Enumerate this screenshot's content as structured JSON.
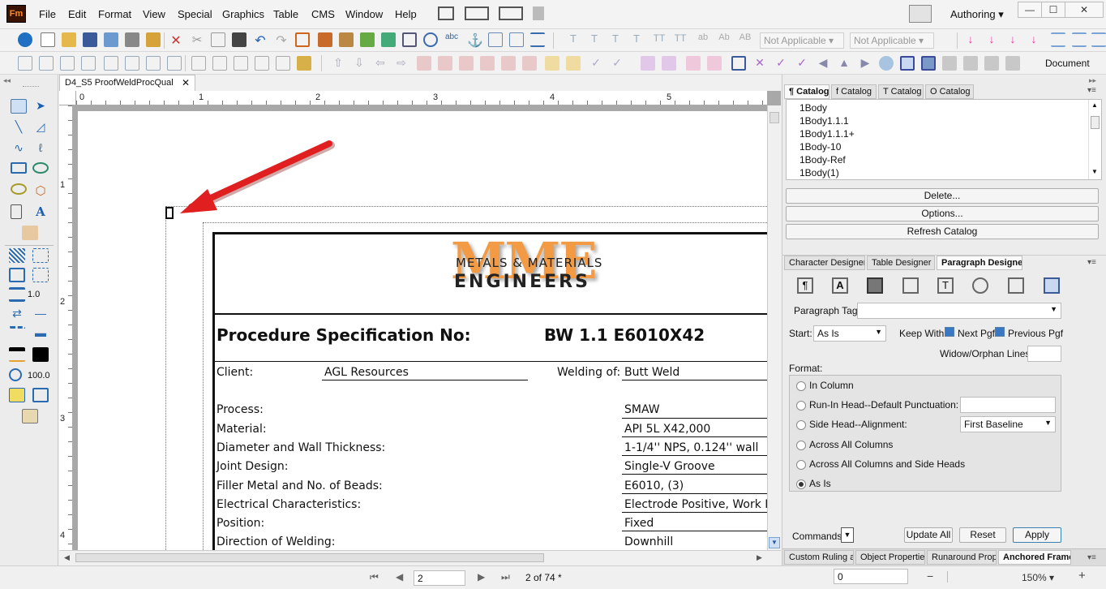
{
  "app": {
    "logo": "Fm",
    "workspace": "Authoring"
  },
  "menu": [
    "File",
    "Edit",
    "Format",
    "View",
    "Special",
    "Graphics",
    "Table",
    "CMS",
    "Window",
    "Help"
  ],
  "window_controls": {
    "minimize": "—",
    "maximize": "☐",
    "close": "✕"
  },
  "toolbar": {
    "char_dd1": "Not Applicable",
    "char_dd2": "Not Applicable",
    "document_label": "Document"
  },
  "tools": {
    "line_width": "1.0",
    "zoom_tint": "100.0"
  },
  "document": {
    "tab_title": "D4_S5 ProofWeldProcQual",
    "ruler_h": [
      "0",
      "1",
      "2",
      "3",
      "4",
      "5"
    ],
    "ruler_v": [
      "1",
      "2",
      "3",
      "4"
    ],
    "logo_top": "Metals & Materials",
    "logo_bottom": "Engineers",
    "logo_watermark": "MME",
    "spec_label": "Procedure Specification No:",
    "spec_value": "BW 1.1 E6010X42",
    "client_label": "Client:",
    "client_value": "AGL Resources",
    "welding_label": "Welding of:",
    "welding_value": "Butt Weld",
    "rows": [
      {
        "label": "Process:",
        "value": "SMAW"
      },
      {
        "label": "Material:",
        "value": "API 5L X42,000"
      },
      {
        "label": "Diameter and Wall Thickness:",
        "value": "1-1/4'' NPS, 0.124'' wall"
      },
      {
        "label": "Joint Design:",
        "value": "Single-V Groove"
      },
      {
        "label": "Filler Metal and No. of Beads:",
        "value": "E6010, (3)"
      },
      {
        "label": "Electrical Characteristics:",
        "value": "Electrode Positive, Work N"
      },
      {
        "label": "Position:",
        "value": "Fixed"
      },
      {
        "label": "Direction of Welding:",
        "value": "Downhill"
      }
    ]
  },
  "catalog": {
    "tabs": [
      "¶ Catalog",
      "f Catalog",
      "T Catalog",
      "O Catalog"
    ],
    "items": [
      "1Body",
      "1Body1.1.1",
      "1Body1.1.1+",
      "1Body-10",
      "1Body-Ref",
      "1Body(1)"
    ],
    "delete": "Delete...",
    "options": "Options...",
    "refresh": "Refresh Catalog"
  },
  "designer": {
    "tabs": [
      "Character Designer",
      "Table Designer",
      "Paragraph Designer"
    ],
    "tag_label": "Paragraph Tag:",
    "tag_value": "",
    "start_label": "Start:",
    "start_value": "As Is",
    "keep_with": "Keep With:",
    "next_pgf": "Next Pgf",
    "prev_pgf": "Previous Pgf",
    "widow_label": "Widow/Orphan Lines:",
    "widow_value": "",
    "format_label": "Format:",
    "options": [
      "In Column",
      "Run-In Head--Default Punctuation:",
      "Side Head--Alignment:",
      "Across All Columns",
      "Across All Columns and Side Heads",
      "As Is"
    ],
    "selected": "As Is",
    "alignment_value": "First Baseline",
    "runin_value": "",
    "commands_label": "Commands:",
    "update_all": "Update All",
    "reset": "Reset",
    "apply": "Apply"
  },
  "bottom_tabs": [
    "Custom Ruling an",
    "Object Properties",
    "Runaround Prope",
    "Anchored Frame"
  ],
  "status": {
    "page_input": "2",
    "page_count": "2 of 74 *",
    "coord_input": "0",
    "zoom": "150%"
  },
  "colors": {
    "accent": "#3b78c4",
    "arrow": "#e02020",
    "logo_orange": "#f08a24"
  }
}
